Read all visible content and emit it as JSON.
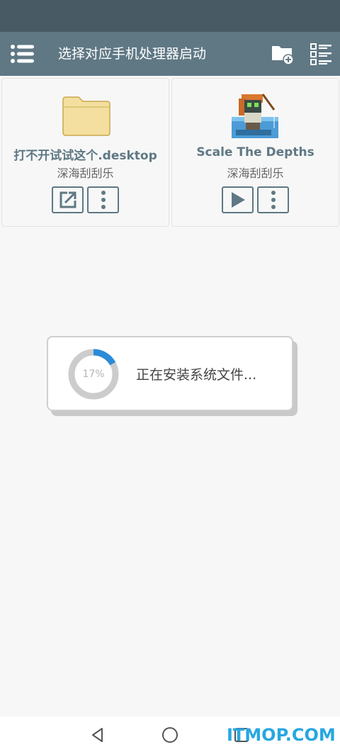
{
  "app_bar": {
    "title": "选择对应手机处理器启动",
    "icons": [
      "list-menu-icon",
      "new-folder-icon",
      "list-view-icon"
    ]
  },
  "cards": [
    {
      "name": "打不开试试这个.desktop",
      "subtitle": "深海刮刮乐",
      "thumbnail_icon": "folder-icon",
      "buttons": [
        "external-link-icon",
        "more-vertical-icon"
      ]
    },
    {
      "name": "Scale The Depths",
      "subtitle": "深海刮刮乐",
      "thumbnail_icon": "pixel-game-icon",
      "buttons": [
        "play-icon",
        "more-vertical-icon"
      ]
    }
  ],
  "progress_dialog": {
    "percent": 17,
    "percent_label": "17%",
    "message": "正在安装系统文件..."
  },
  "nav_bar": {
    "icons": [
      "back-icon",
      "home-icon",
      "recent-apps-icon"
    ]
  },
  "watermark": "ITMOP.COM",
  "colors": {
    "status_bar": "#485a64",
    "app_bar": "#5f7884",
    "accent_blue": "#2a8bd8",
    "ring_track": "#cccccc",
    "watermark": "#27a7e1"
  }
}
